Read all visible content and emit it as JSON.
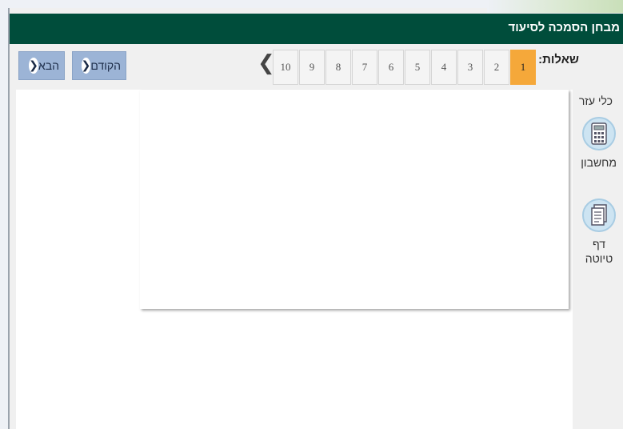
{
  "header": {
    "title": "מבחן הסמכה לסיעוד"
  },
  "questions": {
    "label": "שאלות:",
    "pages": [
      "1",
      "2",
      "3",
      "4",
      "5",
      "6",
      "7",
      "8",
      "9",
      "10"
    ],
    "active": "1",
    "more_arrow": "❮"
  },
  "nav": {
    "prev_label": "הקודם",
    "next_label": "הבא",
    "arrow": "❮"
  },
  "tools": {
    "title": "כלי עזר",
    "items": [
      {
        "label": "מחשבון",
        "icon": "calculator-icon"
      },
      {
        "label_line1": "דף",
        "label_line2": "טיוטה",
        "icon": "notepad-icon"
      }
    ]
  },
  "colors": {
    "header": "#004d3b",
    "active_page": "#f5a83a",
    "nav_button": "#9cb4d6"
  }
}
